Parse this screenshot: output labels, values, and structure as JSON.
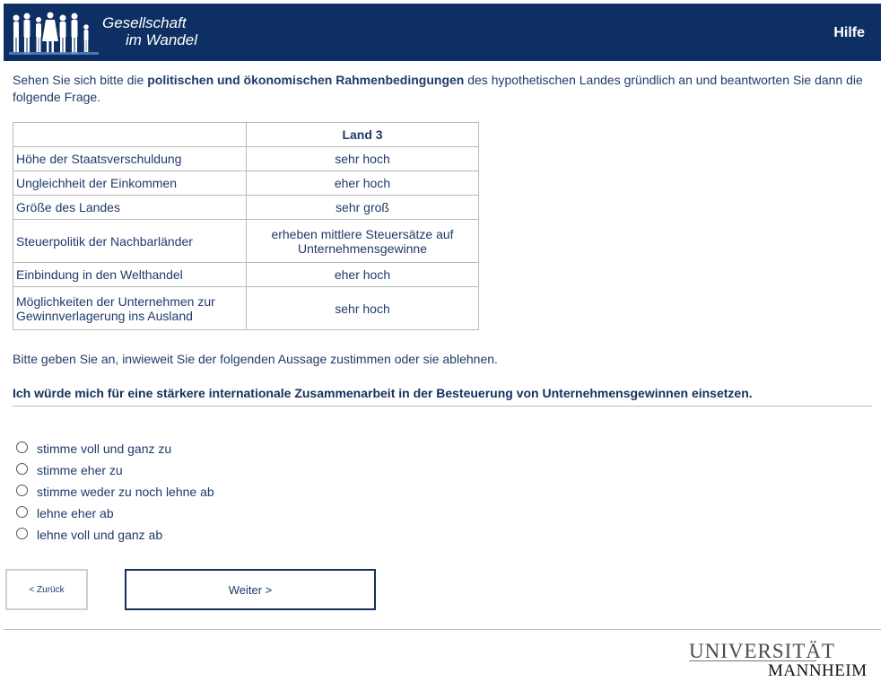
{
  "header": {
    "logo_line1": "Gesellschaft",
    "logo_line2": "im Wandel",
    "help_link": "Hilfe",
    "logo_icon": "people-silhouettes-icon"
  },
  "intro": {
    "before": "Sehen Sie sich bitte die ",
    "bold": "politischen und ökonomischen Rahmenbedingungen",
    "after": " des hypothetischen Landes gründlich an und beantworten Sie dann die folgende Frage."
  },
  "table": {
    "header_label": "",
    "header_value": "Land 3",
    "rows": [
      {
        "label": "Höhe der Staatsverschuldung",
        "value": "sehr hoch"
      },
      {
        "label": "Ungleichheit der Einkommen",
        "value": "eher hoch"
      },
      {
        "label": "Größe des Landes",
        "value": "sehr groß"
      },
      {
        "label": "Steuerpolitik der Nachbarländer",
        "value": "erheben mittlere Steuersätze auf Unternehmensgewinne"
      },
      {
        "label": "Einbindung in den Welthandel",
        "value": "eher hoch"
      },
      {
        "label": "Möglichkeiten der Unternehmen zur Gewinnverlagerung ins Ausland",
        "value": "sehr hoch"
      }
    ]
  },
  "question": {
    "instruction": "Bitte geben Sie an, inwieweit Sie der folgenden Aussage zustimmen oder sie ablehnen.",
    "statement": "Ich würde mich für eine stärkere internationale Zusammenarbeit in der Besteuerung von Unternehmensgewinnen einsetzen.",
    "options": [
      "stimme voll und ganz zu",
      "stimme eher zu",
      "stimme weder zu noch lehne ab",
      "lehne eher ab",
      "lehne voll und ganz ab"
    ],
    "selected": null
  },
  "nav": {
    "back_label": "< Zurück",
    "next_label": "Weiter >"
  },
  "footer": {
    "uni_line1": "UNIVERSITÄT",
    "uni_line2": "MANNHEIM"
  }
}
